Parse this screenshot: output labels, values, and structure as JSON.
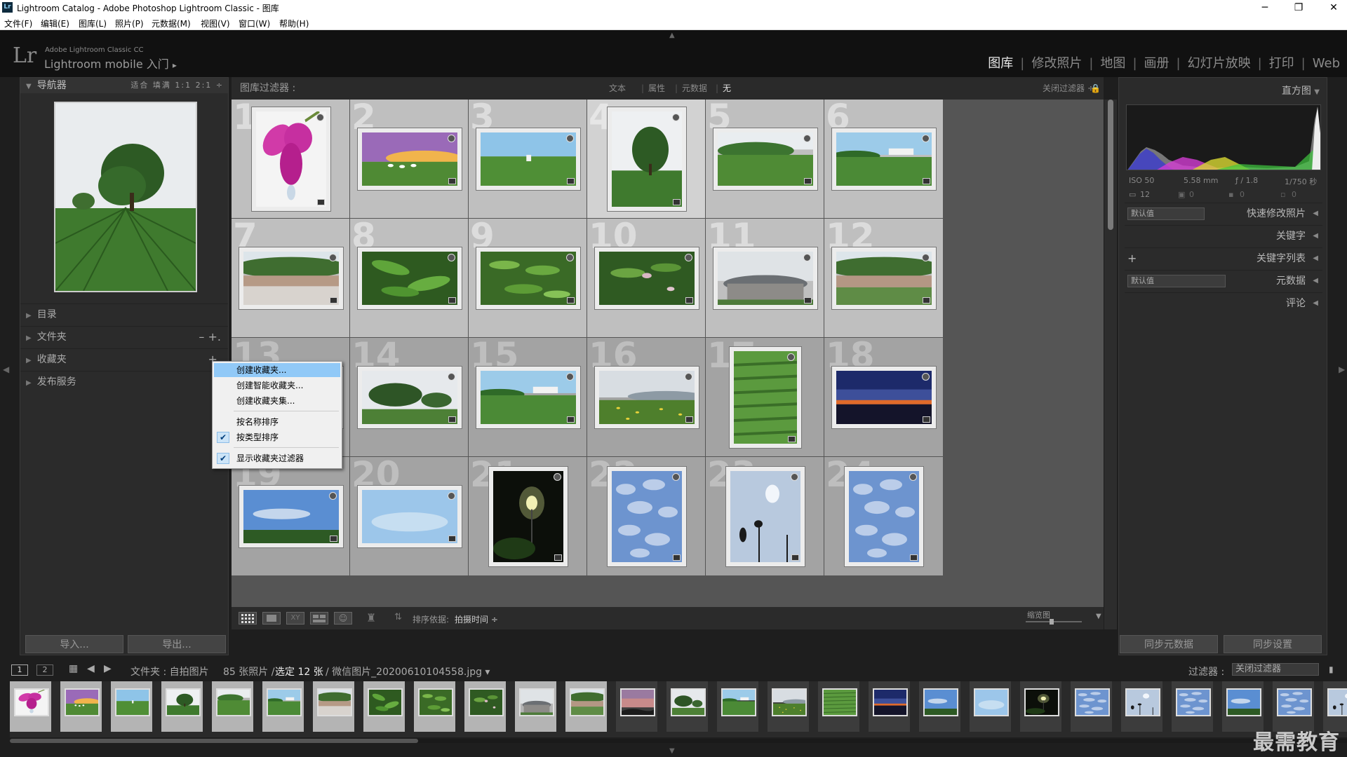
{
  "window": {
    "icon_text": "Lr",
    "title": "Lightroom Catalog - Adobe Photoshop Lightroom Classic - 图库"
  },
  "menu": [
    "文件(F)",
    "编辑(E)",
    "图库(L)",
    "照片(P)",
    "元数据(M)",
    "视图(V)",
    "窗口(W)",
    "帮助(H)"
  ],
  "identity": {
    "logo": "Lr",
    "small": "Adobe Lightroom Classic CC",
    "big": "Lightroom mobile 入门",
    "arrow": "▸"
  },
  "modules": [
    {
      "label": "图库",
      "active": true
    },
    {
      "label": "修改照片",
      "active": false
    },
    {
      "label": "地图",
      "active": false
    },
    {
      "label": "画册",
      "active": false
    },
    {
      "label": "幻灯片放映",
      "active": false
    },
    {
      "label": "打印",
      "active": false
    },
    {
      "label": "Web",
      "active": false
    }
  ],
  "left": {
    "navigator": {
      "title": "导航器",
      "options": "适合  填满  1:1  2:1 ÷"
    },
    "sections": [
      {
        "label": "目录",
        "action": ""
      },
      {
        "label": "文件夹",
        "action": "–  +."
      },
      {
        "label": "收藏夹",
        "action": "+."
      },
      {
        "label": "发布服务",
        "action": ""
      }
    ],
    "import_label": "导入...",
    "export_label": "导出..."
  },
  "context_menu": [
    {
      "label": "创建收藏夹...",
      "checked": false,
      "highlighted": true
    },
    {
      "label": "创建智能收藏夹...",
      "checked": false,
      "highlighted": false
    },
    {
      "label": "创建收藏夹集...",
      "checked": false,
      "highlighted": false
    },
    {
      "label": "按名称排序",
      "checked": false,
      "highlighted": false
    },
    {
      "label": "按类型排序",
      "checked": true,
      "highlighted": false
    },
    {
      "label": "显示收藏夹过滤器",
      "checked": true,
      "highlighted": false
    }
  ],
  "filter_bar": {
    "label": "图库过滤器 :",
    "items": [
      "文本",
      "属性",
      "元数据",
      "无"
    ],
    "active": "无",
    "close_label": "关闭过滤器 ÷"
  },
  "grid": {
    "cells": [
      {
        "n": "1",
        "sel": true,
        "img": "flower"
      },
      {
        "n": "2",
        "sel": true,
        "img": "sunset-field"
      },
      {
        "n": "3",
        "sel": true,
        "img": "tea-person"
      },
      {
        "n": "4",
        "sel": true,
        "img": "tree-tall",
        "primary": true
      },
      {
        "n": "5",
        "sel": true,
        "img": "tea-hill"
      },
      {
        "n": "6",
        "sel": true,
        "img": "tea-house"
      },
      {
        "n": "7",
        "sel": true,
        "img": "wall"
      },
      {
        "n": "8",
        "sel": true,
        "img": "leaves"
      },
      {
        "n": "9",
        "sel": true,
        "img": "leaves2"
      },
      {
        "n": "10",
        "sel": true,
        "img": "leaves3"
      },
      {
        "n": "11",
        "sel": true,
        "img": "building"
      },
      {
        "n": "12",
        "sel": true,
        "img": "wall2"
      },
      {
        "n": "13",
        "sel": false,
        "img": "dusk"
      },
      {
        "n": "14",
        "sel": false,
        "img": "tree-wide"
      },
      {
        "n": "15",
        "sel": false,
        "img": "tea-house"
      },
      {
        "n": "16",
        "sel": false,
        "img": "rape-field"
      },
      {
        "n": "17",
        "sel": false,
        "img": "tea-rows"
      },
      {
        "n": "18",
        "sel": false,
        "img": "night-sky"
      },
      {
        "n": "19",
        "sel": false,
        "img": "blue-sky-trees"
      },
      {
        "n": "20",
        "sel": false,
        "img": "sky"
      },
      {
        "n": "21",
        "sel": false,
        "img": "lamp"
      },
      {
        "n": "22",
        "sel": false,
        "img": "clouds"
      },
      {
        "n": "23",
        "sel": false,
        "img": "silhouette"
      },
      {
        "n": "24",
        "sel": false,
        "img": "clouds"
      }
    ]
  },
  "toolbar": {
    "sort_label": "排序依据:",
    "sort_value": "拍摄时间 ÷",
    "thumb_label": "缩览图"
  },
  "right": {
    "histogram_title": "直方图",
    "exif": {
      "iso": "ISO 50",
      "focal": "5.58 mm",
      "aperture": "ƒ / 1.8",
      "shutter": "1/750 秒",
      "count1": "12",
      "count2": "0",
      "count3": "0",
      "count4": "0"
    },
    "sections": [
      {
        "label": "快速修改照片",
        "dropdown": "默认值",
        "plus": ""
      },
      {
        "label": "关键字",
        "dropdown": "",
        "plus": ""
      },
      {
        "label": "关键字列表",
        "dropdown": "",
        "plus": "+"
      },
      {
        "label": "元数据",
        "dropdown": "默认值",
        "plus": ""
      },
      {
        "label": "评论",
        "dropdown": "",
        "plus": ""
      }
    ],
    "sync_metadata": "同步元数据",
    "sync_settings": "同步设置"
  },
  "filmstrip_bar": {
    "page1": "1",
    "page2": "2",
    "source": "文件夹 : 自拍图片",
    "count": "85 张照片 /",
    "selected": "选定 12 张",
    "filename": "/ 微信图片_20200610104558.jpg ▾",
    "filter_label": "过滤器 :",
    "filter_value": "关闭过滤器"
  },
  "watermark": "最需教育",
  "colors": {
    "accent_highlight": "#91c9f7",
    "panel": "#2b2b2b",
    "selected_cell": "#d2d2d2"
  }
}
